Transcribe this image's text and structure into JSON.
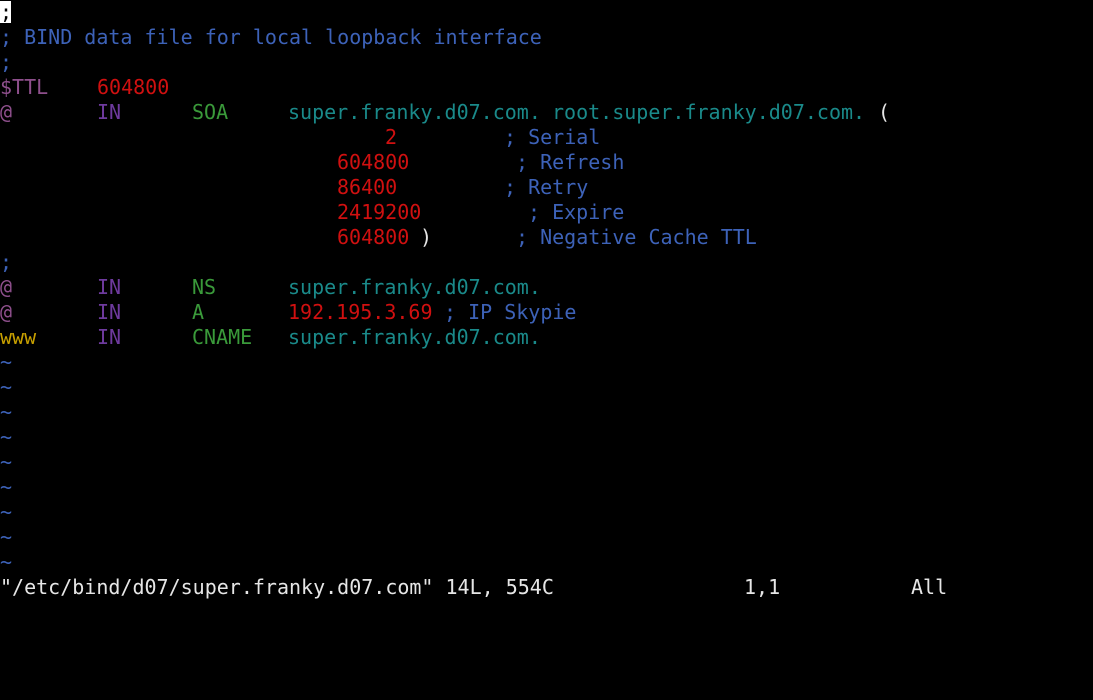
{
  "editor": {
    "lines": {
      "l1": {
        "semi": ";"
      },
      "l2": {
        "comment": "; BIND data file for local loopback interface"
      },
      "l3": {
        "semi": ";"
      },
      "l4": {
        "directive": "$TTL",
        "value": "604800"
      },
      "l5": {
        "owner": "@",
        "class": "IN",
        "type": "SOA",
        "mname": "super.franky.d07.com.",
        "rname": "root.super.franky.d07.com.",
        "paren": "("
      },
      "l6": {
        "value": "2",
        "comment": "; Serial"
      },
      "l7": {
        "value": "604800",
        "comment": "; Refresh"
      },
      "l8": {
        "value": "86400",
        "comment": "; Retry"
      },
      "l9": {
        "value": "2419200",
        "comment": "; Expire"
      },
      "l10": {
        "value": "604800",
        "paren": ")",
        "comment": "; Negative Cache TTL"
      },
      "l11": {
        "semi": ";"
      },
      "l12": {
        "owner": "@",
        "class": "IN",
        "type": "NS",
        "data": "super.franky.d07.com."
      },
      "l13": {
        "owner": "@",
        "class": "IN",
        "type": "A",
        "data": "192.195.3.69",
        "comment": "; IP Skypie"
      },
      "l14": {
        "owner": "www",
        "class": "IN",
        "type": "CNAME",
        "data": "super.franky.d07.com."
      }
    },
    "tilde": "~"
  },
  "status_bar": {
    "file_info": "\"/etc/bind/d07/super.franky.d07.com\" 14L, 554C",
    "position": "1,1",
    "scroll": "All"
  },
  "colors": {
    "background": "#000000",
    "comment": "#3d62b8",
    "number": "#d01010",
    "keyword": "#3a9a3a",
    "hostname": "#1a8a8a",
    "www": "#c8a000"
  }
}
